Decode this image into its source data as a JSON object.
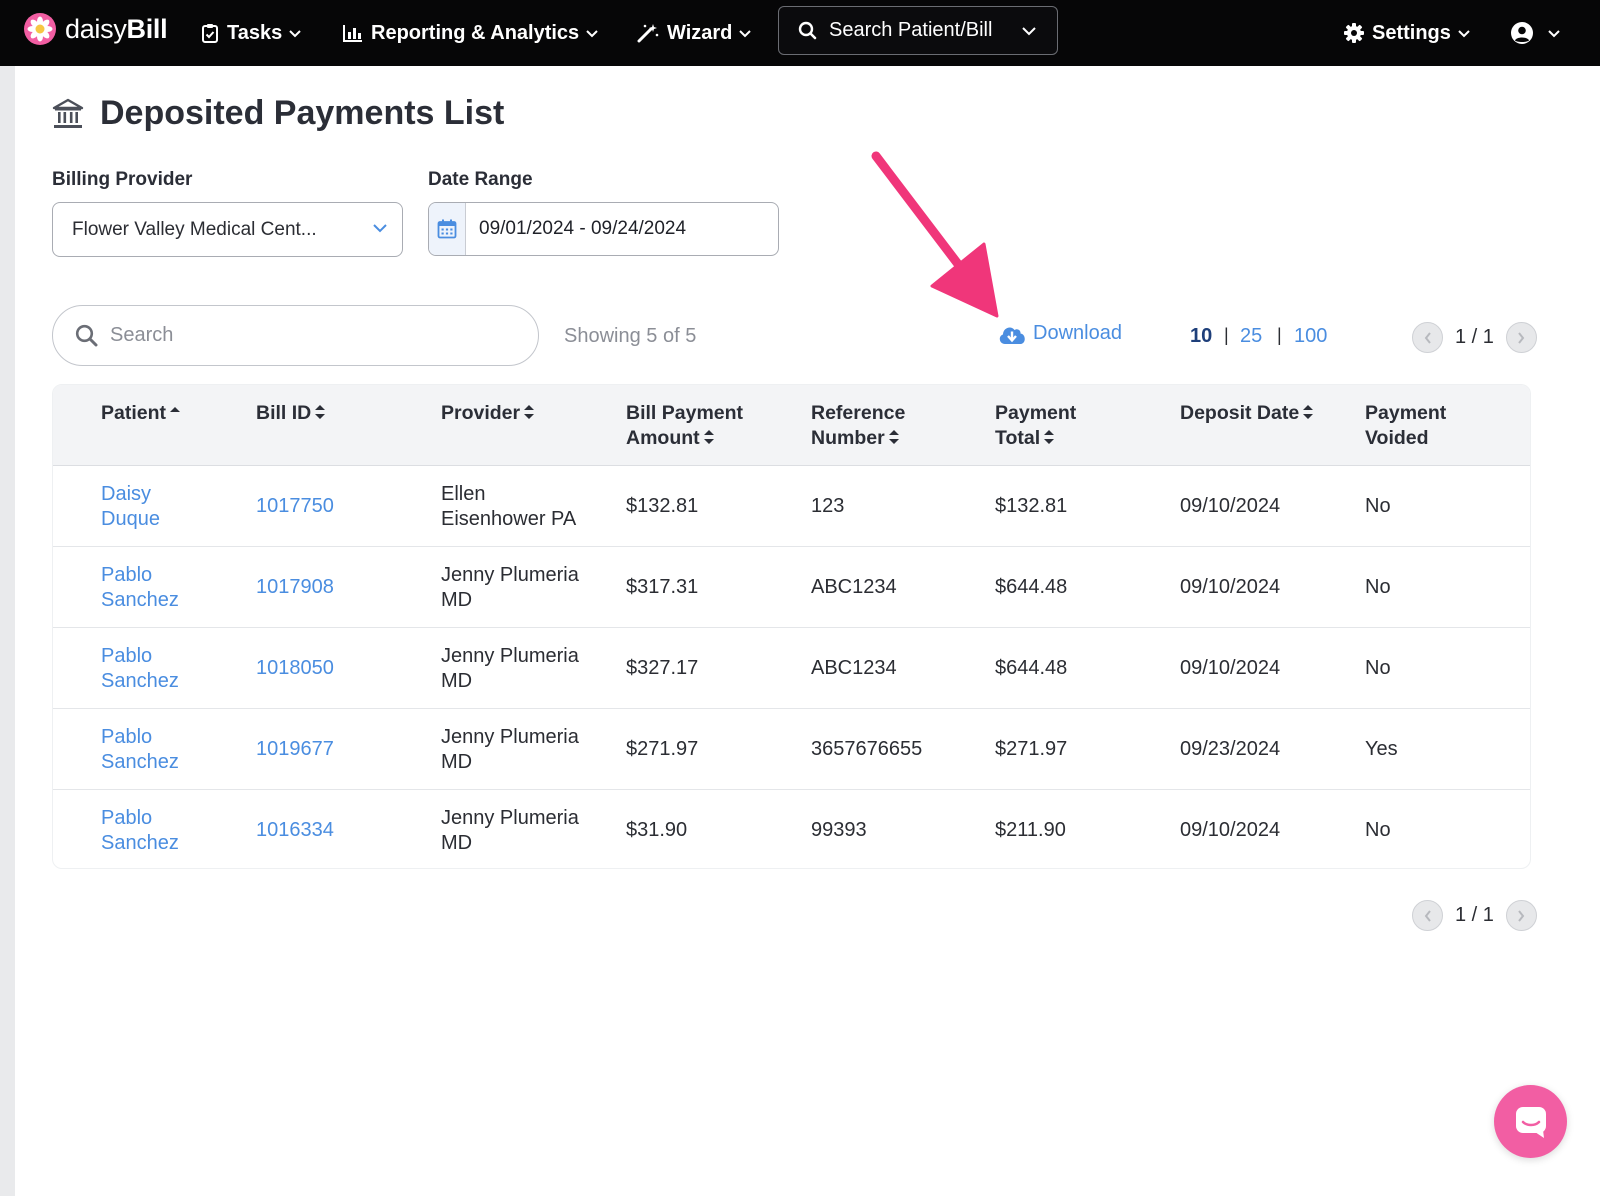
{
  "nav": {
    "brand_light": "daisy",
    "brand_bold": "Bill",
    "tasks": "Tasks",
    "reporting": "Reporting & Analytics",
    "wizard": "Wizard",
    "search": "Search Patient/Bill",
    "settings": "Settings"
  },
  "page": {
    "title": "Deposited Payments List",
    "billing_provider_label": "Billing Provider",
    "billing_provider_value": "Flower Valley Medical Cent...",
    "date_range_label": "Date Range",
    "date_range_value": "09/01/2024 - 09/24/2024",
    "search_placeholder": "Search",
    "showing": "Showing 5 of 5",
    "download": "Download",
    "page_sizes": [
      "10",
      "25",
      "100"
    ],
    "pager_text": "1 / 1"
  },
  "table": {
    "headers": {
      "patient": "Patient",
      "bill_id": "Bill ID",
      "provider": "Provider",
      "bill_payment_amount_1": "Bill Payment",
      "bill_payment_amount_2": "Amount",
      "reference_number_1": "Reference",
      "reference_number_2": "Number",
      "payment_total_1": "Payment",
      "payment_total_2": "Total",
      "deposit_date": "Deposit Date",
      "payment_voided_1": "Payment",
      "payment_voided_2": "Voided"
    },
    "rows": [
      {
        "patient_1": "Daisy",
        "patient_2": "Duque",
        "bill_id": "1017750",
        "provider_1": "Ellen",
        "provider_2": "Eisenhower PA",
        "amount": "$132.81",
        "reference": "123",
        "total": "$132.81",
        "deposit_date": "09/10/2024",
        "voided": "No"
      },
      {
        "patient_1": "Pablo",
        "patient_2": "Sanchez",
        "bill_id": "1017908",
        "provider_1": "Jenny Plumeria",
        "provider_2": "MD",
        "amount": "$317.31",
        "reference": "ABC1234",
        "total": "$644.48",
        "deposit_date": "09/10/2024",
        "voided": "No"
      },
      {
        "patient_1": "Pablo",
        "patient_2": "Sanchez",
        "bill_id": "1018050",
        "provider_1": "Jenny Plumeria",
        "provider_2": "MD",
        "amount": "$327.17",
        "reference": "ABC1234",
        "total": "$644.48",
        "deposit_date": "09/10/2024",
        "voided": "No"
      },
      {
        "patient_1": "Pablo",
        "patient_2": "Sanchez",
        "bill_id": "1019677",
        "provider_1": "Jenny Plumeria",
        "provider_2": "MD",
        "amount": "$271.97",
        "reference": "3657676655",
        "total": "$271.97",
        "deposit_date": "09/23/2024",
        "voided": "Yes"
      },
      {
        "patient_1": "Pablo",
        "patient_2": "Sanchez",
        "bill_id": "1016334",
        "provider_1": "Jenny Plumeria",
        "provider_2": "MD",
        "amount": "$31.90",
        "reference": "99393",
        "total": "$211.90",
        "deposit_date": "09/10/2024",
        "voided": "No"
      }
    ]
  },
  "colors": {
    "navbar": "#060607",
    "link": "#4a8de0",
    "active_page_size": "#1e3f7a",
    "annotation_arrow": "#f0367a",
    "chat_bubble": "#f25ea3"
  },
  "icons": {
    "brand": "daisy-flower-icon",
    "tasks": "clipboard-check-icon",
    "reporting": "bar-chart-icon",
    "wizard": "magic-wand-icon",
    "search": "search-icon",
    "settings": "gear-icon",
    "user": "user-circle-icon",
    "title": "bank-icon",
    "date": "calendar-icon",
    "download": "cloud-download-icon",
    "chat": "chat-bubble-icon"
  }
}
